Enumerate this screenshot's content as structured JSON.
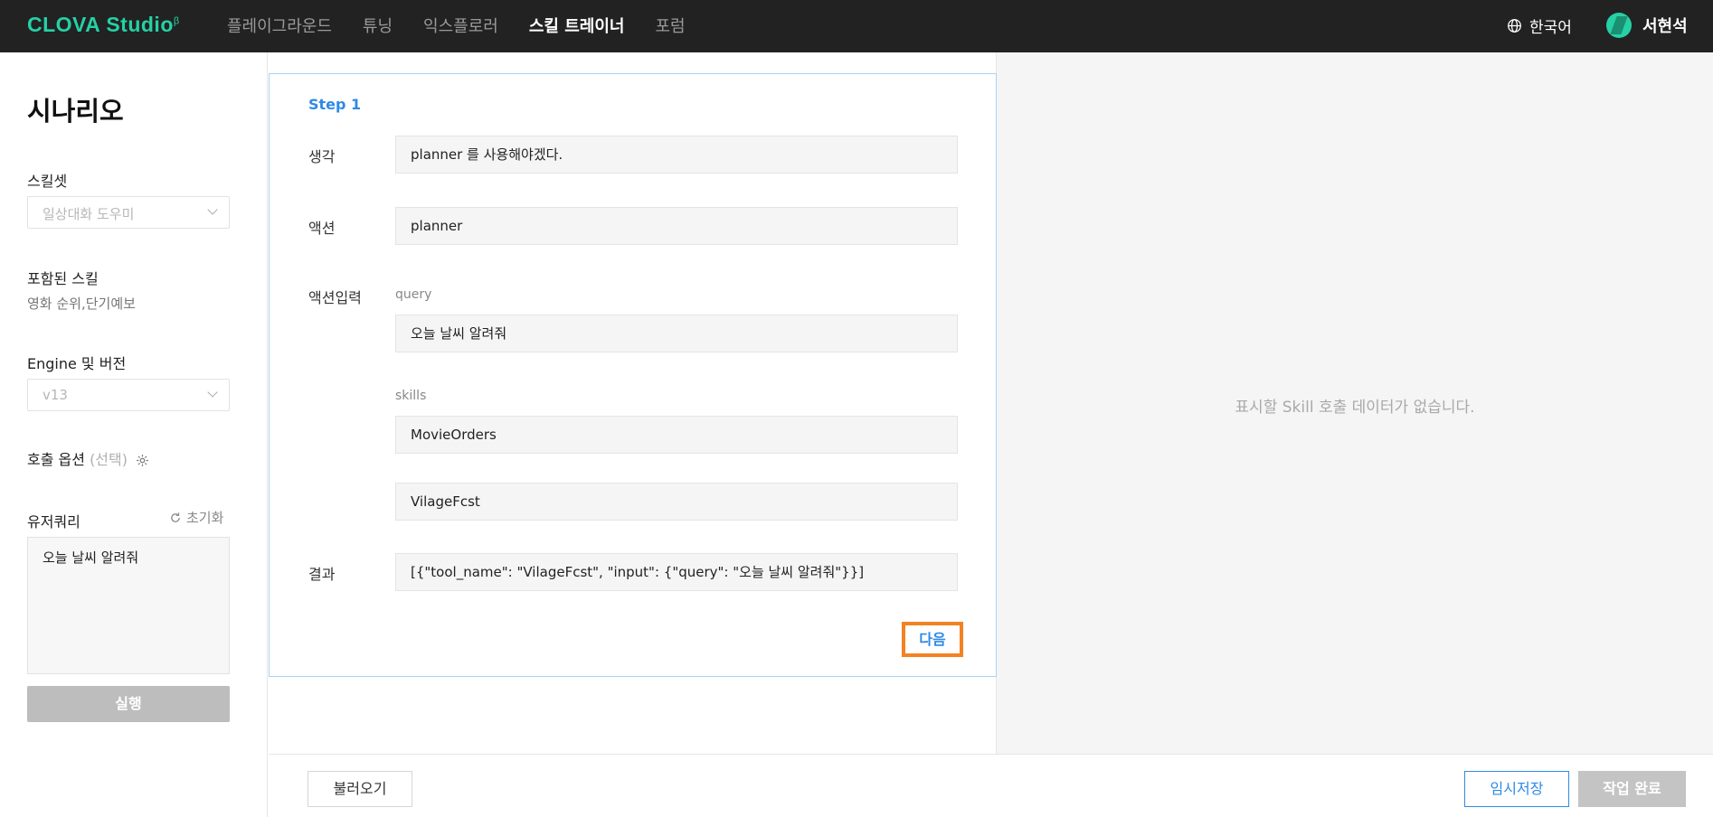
{
  "header": {
    "logo_text": "CLOVA Studio",
    "logo_sup": "β",
    "nav": [
      {
        "label": "플레이그라운드",
        "active": false
      },
      {
        "label": "튜닝",
        "active": false
      },
      {
        "label": "익스플로러",
        "active": false
      },
      {
        "label": "스킬 트레이너",
        "active": true
      },
      {
        "label": "포럼",
        "active": false
      }
    ],
    "language": "한국어",
    "user_name": "서현석",
    "language_icon": "globe-icon"
  },
  "sidebar": {
    "title": "시나리오",
    "skillset_label": "스킬셋",
    "skillset_value": "일상대화 도우미",
    "included_skills_label": "포함된 스킬",
    "included_skills_value": "영화 순위,단기예보",
    "engine_label": "Engine 및 버전",
    "engine_value": "v13",
    "call_option_label": "호출 옵션",
    "call_option_optional": "(선택)",
    "user_query_label": "유저쿼리",
    "reset_label": "초기화",
    "user_query_value": "오늘 날씨 알려줘",
    "run_label": "실행"
  },
  "step": {
    "title": "Step 1",
    "thought_label": "생각",
    "thought_value": "planner 를 사용해야겠다.",
    "action_label": "액션",
    "action_value": "planner",
    "action_input_label": "액션입력",
    "query_label": "query",
    "query_value": "오늘 날씨 알려줘",
    "skills_label": "skills",
    "skills": [
      "MovieOrders",
      "VilageFcst"
    ],
    "result_label": "결과",
    "result_value": "[{\"tool_name\": \"VilageFcst\", \"input\": {\"query\": \"오늘 날씨 알려줘\"}}]",
    "next_label": "다음"
  },
  "right_panel": {
    "empty_message": "표시할 Skill 호출 데이터가 없습니다."
  },
  "footer": {
    "load_label": "불러오기",
    "temp_save_label": "임시저장",
    "complete_label": "작업 완료"
  },
  "colors": {
    "brand": "#26d0a5",
    "accent_blue": "#2f8ae6",
    "highlight_orange": "#f28222",
    "topbar_bg": "#222222"
  }
}
